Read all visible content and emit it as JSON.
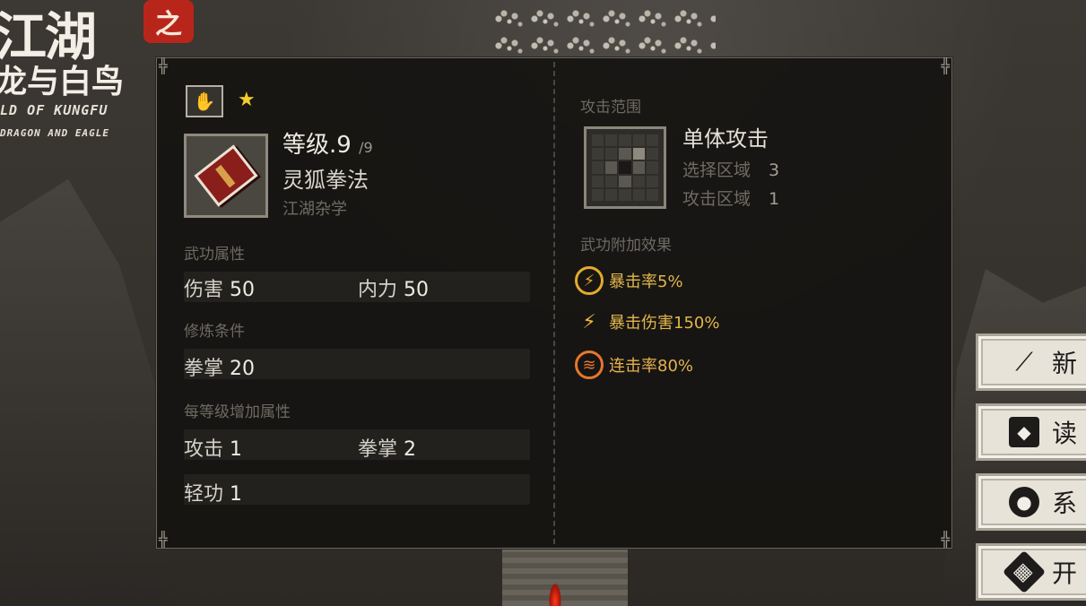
{
  "logo": {
    "title": "江湖",
    "seal": "之",
    "subtitle": "龙与白鸟",
    "en_line1": "LD OF KUNGFU",
    "en_line2": "DRAGON AND EAGLE"
  },
  "panel": {
    "header": {
      "hand_icon": "palm-icon",
      "star": "★"
    },
    "level_label": "等级",
    "level_value": ".9",
    "level_max": "/9",
    "skill_name": "灵狐拳法",
    "skill_type": "江湖杂学",
    "section_attrs": "武功属性",
    "attrs": [
      {
        "label": "伤害",
        "value": "50"
      },
      {
        "label": "内力",
        "value": "50"
      }
    ],
    "section_req": "修炼条件",
    "requirements": [
      {
        "label": "拳掌",
        "value": "20"
      }
    ],
    "section_per_level": "每等级增加属性",
    "per_level": [
      {
        "label": "攻击",
        "value": "1"
      },
      {
        "label": "拳掌",
        "value": "2"
      },
      {
        "label": "轻功",
        "value": "1"
      }
    ],
    "range_section": "攻击范围",
    "range_title": "单体攻击",
    "range_select_label": "选择区域",
    "range_select_value": "3",
    "range_attack_label": "攻击区域",
    "range_attack_value": "1",
    "effects_section": "武功附加效果",
    "effects": [
      {
        "icon": "crit-rate-icon",
        "text": "暴击率5%"
      },
      {
        "icon": "crit-damage-icon",
        "text": "暴击伤害150%"
      },
      {
        "icon": "combo-rate-icon",
        "text": "连击率80%"
      }
    ]
  },
  "menu": [
    {
      "icon": "brush-icon",
      "label": "新"
    },
    {
      "icon": "book-icon",
      "label": "读"
    },
    {
      "icon": "pouch-icon",
      "label": "系"
    },
    {
      "icon": "scroll-icon",
      "label": "开"
    }
  ],
  "colors": {
    "panel_bg": "#141311",
    "accent_gold": "#e2b64b",
    "seal_red": "#b8261b"
  }
}
